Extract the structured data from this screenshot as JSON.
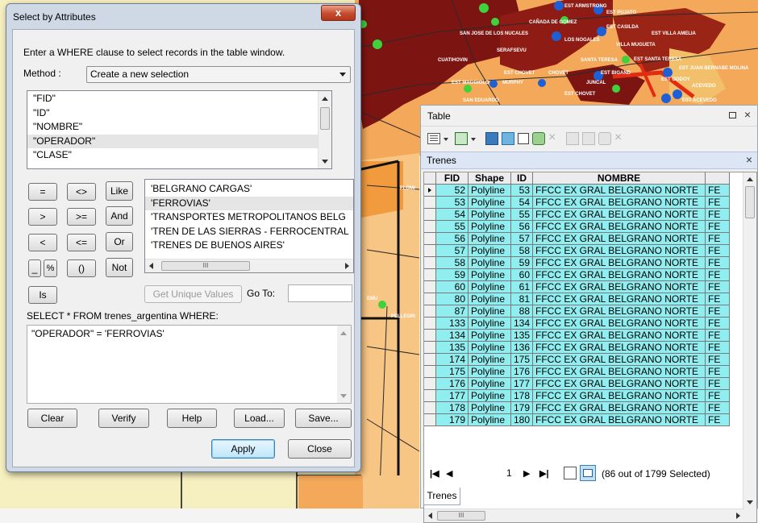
{
  "dialog": {
    "title": "Select by Attributes",
    "close_glyph": "x",
    "instruction": "Enter a WHERE clause to select records in the table window.",
    "method_label": "Method :",
    "method_value": "Create a new selection",
    "fields": [
      "\"FID\"",
      "\"ID\"",
      "\"NOMBRE\"",
      "\"OPERADOR\"",
      "\"CLASE\""
    ],
    "operators": [
      "=",
      "<>",
      "Like",
      ">",
      ">=",
      "And",
      "<",
      "<=",
      "Or",
      "_",
      "%",
      "()",
      "Not"
    ],
    "is_label": "Is",
    "values": [
      "'BELGRANO CARGAS'",
      "'FERROVIAS'",
      "'TRANSPORTES METROPOLITANOS BELG",
      "'TREN DE LAS SIERRAS - FERROCENTRAL",
      "'TRENES DE BUENOS AIRES'"
    ],
    "scroll_glyph": "III",
    "get_unique_label": "Get Unique Values",
    "goto_label": "Go To:",
    "goto_value": "",
    "select_from": "SELECT * FROM trenes_argentina WHERE:",
    "query": "\"OPERADOR\" = 'FERROVIAS'",
    "buttons": {
      "clear": "Clear",
      "verify": "Verify",
      "help": "Help",
      "load": "Load...",
      "save": "Save...",
      "apply": "Apply",
      "close": "Close"
    }
  },
  "table": {
    "title": "Table",
    "subtab": "Trenes",
    "columns": [
      "FID",
      "Shape",
      "ID",
      "NOMBRE",
      ""
    ],
    "rows": [
      [
        "52",
        "Polyline",
        "53",
        "FFCC EX GRAL BELGRANO NORTE",
        "FE"
      ],
      [
        "53",
        "Polyline",
        "54",
        "FFCC EX GRAL BELGRANO NORTE",
        "FE"
      ],
      [
        "54",
        "Polyline",
        "55",
        "FFCC EX GRAL BELGRANO NORTE",
        "FE"
      ],
      [
        "55",
        "Polyline",
        "56",
        "FFCC EX GRAL BELGRANO NORTE",
        "FE"
      ],
      [
        "56",
        "Polyline",
        "57",
        "FFCC EX GRAL BELGRANO NORTE",
        "FE"
      ],
      [
        "57",
        "Polyline",
        "58",
        "FFCC EX GRAL BELGRANO NORTE",
        "FE"
      ],
      [
        "58",
        "Polyline",
        "59",
        "FFCC EX GRAL BELGRANO NORTE",
        "FE"
      ],
      [
        "59",
        "Polyline",
        "60",
        "FFCC EX GRAL BELGRANO NORTE",
        "FE"
      ],
      [
        "60",
        "Polyline",
        "61",
        "FFCC EX GRAL BELGRANO NORTE",
        "FE"
      ],
      [
        "80",
        "Polyline",
        "81",
        "FFCC EX GRAL BELGRANO NORTE",
        "FE"
      ],
      [
        "87",
        "Polyline",
        "88",
        "FFCC EX GRAL BELGRANO NORTE",
        "FE"
      ],
      [
        "133",
        "Polyline",
        "134",
        "FFCC EX GRAL BELGRANO NORTE",
        "FE"
      ],
      [
        "134",
        "Polyline",
        "135",
        "FFCC EX GRAL BELGRANO NORTE",
        "FE"
      ],
      [
        "135",
        "Polyline",
        "136",
        "FFCC EX GRAL BELGRANO NORTE",
        "FE"
      ],
      [
        "174",
        "Polyline",
        "175",
        "FFCC EX GRAL BELGRANO NORTE",
        "FE"
      ],
      [
        "175",
        "Polyline",
        "176",
        "FFCC EX GRAL BELGRANO NORTE",
        "FE"
      ],
      [
        "176",
        "Polyline",
        "177",
        "FFCC EX GRAL BELGRANO NORTE",
        "FE"
      ],
      [
        "177",
        "Polyline",
        "178",
        "FFCC EX GRAL BELGRANO NORTE",
        "FE"
      ],
      [
        "178",
        "Polyline",
        "179",
        "FFCC EX GRAL BELGRANO NORTE",
        "FE"
      ],
      [
        "179",
        "Polyline",
        "180",
        "FFCC EX GRAL BELGRANO NORTE",
        "FE"
      ]
    ],
    "h_scroll_glyph": "III",
    "nav_page": "1",
    "selection_status": "(86 out of 1799 Selected)",
    "bottom_tab": "Trenes"
  },
  "map": {
    "labels": [
      "EST ARMSTRONG",
      "EST PUJATO",
      "CAÑADA DE GOMEZ",
      "SAN JOSE DE LOS NUCALES",
      "EST CASILDA",
      "EST VILLA AMELIA",
      "LOS NOGALES",
      "SERAFSEVU",
      "VILLA MUGUETA",
      "CUATIHOVIN",
      "SANTA TERESA",
      "EST SANTA TERESA",
      "EST JUAN BERNABE MOLINA",
      "EST CHOVET",
      "CHOVET",
      "EST BIGAND",
      "EST GODOY",
      "EST MAGGIOLO",
      "MURPHY",
      "JUNCAL",
      "ACEVEDO",
      "EST CHOVET",
      "SAN EDUARDO",
      "EST ACEVEDO",
      "FLOMI",
      "PELLEGRI",
      "EMU"
    ],
    "colors": {
      "dark_red": "#7a1010",
      "brown_red": "#8b1a14",
      "orange": "#f2a64a",
      "light_orange": "#f7c27a",
      "pale_yellow": "#f7f0b8",
      "blue_point": "#1f5fd6",
      "green_point": "#3fd23c"
    }
  }
}
